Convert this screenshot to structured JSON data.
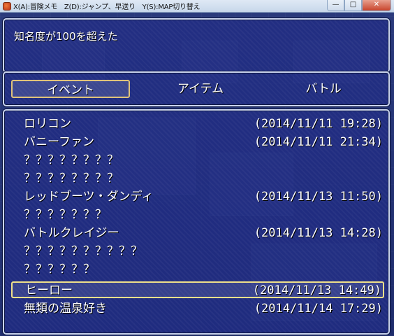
{
  "window": {
    "title": "X(A):冒険メモ　Z(D):ジャンプ、早送り　Y(S):MAP切り替え",
    "min_label": "—",
    "max_label": "□",
    "close_label": "✕"
  },
  "help": {
    "text": "知名度が100を超えた"
  },
  "tabs": [
    {
      "label": "イベント",
      "selected": true
    },
    {
      "label": "アイテム",
      "selected": false
    },
    {
      "label": "バトル",
      "selected": false
    }
  ],
  "entries": [
    {
      "name": "ロリコン",
      "date": "(2014/11/11 19:28)"
    },
    {
      "name": "バニーファン",
      "date": "(2014/11/11 21:34)"
    },
    {
      "name": "？？？？？？？？",
      "date": ""
    },
    {
      "name": "？？？？？？？？",
      "date": ""
    },
    {
      "name": "レッドブーツ・ダンディ",
      "date": "(2014/11/13 11:50)"
    },
    {
      "name": "？？？？？？？",
      "date": ""
    },
    {
      "name": "バトルクレイジー",
      "date": "(2014/11/13 14:28)"
    },
    {
      "name": "？？？？？？？？？？",
      "date": ""
    },
    {
      "name": "？？？？？？",
      "date": ""
    },
    {
      "name": "ヒーロー",
      "date": "(2014/11/13 14:49)"
    },
    {
      "name": "無類の温泉好き",
      "date": "(2014/11/14 17:29)"
    }
  ],
  "selected_entry_index": 9,
  "colors": {
    "panel_border": "#c9d3ef",
    "selection_border": "#efe08a",
    "tab_selection_border": "#e0c37a",
    "text": "#ffffff"
  }
}
